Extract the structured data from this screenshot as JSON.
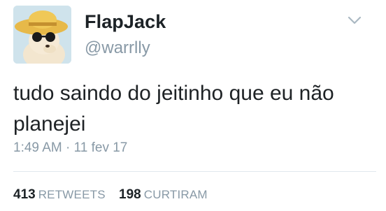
{
  "tweet": {
    "display_name": "FlapJack",
    "handle": "@warrlly",
    "text": "tudo saindo do jeitinho que eu não planejei",
    "time": "1:49 AM",
    "separator": "·",
    "date": "11 fev 17",
    "avatar_icon": "dog-with-straw-hat-and-sunglasses",
    "menu_icon": "chevron-down-icon"
  },
  "stats": {
    "retweets_count": "413",
    "retweets_label": "RETWEETS",
    "likes_count": "198",
    "likes_label": "CURTIRAM"
  },
  "colors": {
    "primary_text": "#14171a",
    "secondary_text": "#8899a6",
    "divider": "#e1e8ed"
  }
}
